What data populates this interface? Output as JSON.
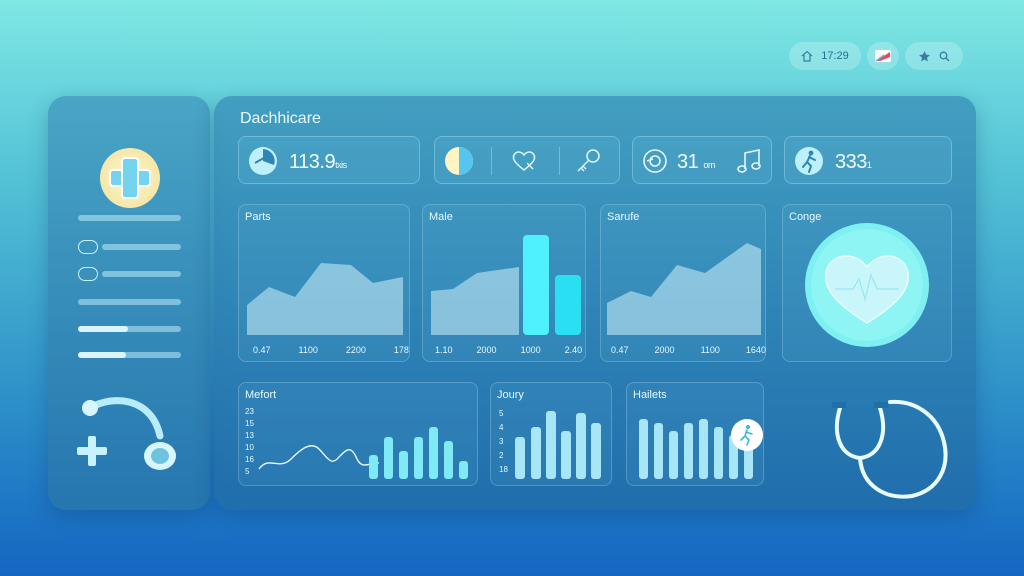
{
  "topbar": {
    "time": "17:29"
  },
  "main": {
    "title": "Dachhicare",
    "stats": [
      {
        "value": "113.9",
        "unit": "txis"
      },
      {
        "value": "31",
        "unit": "om"
      },
      {
        "value": "333",
        "unit": "1"
      }
    ],
    "cards": {
      "parts": {
        "title": "Parts",
        "ticks": [
          "0.47",
          "1100",
          "2200",
          "178"
        ]
      },
      "male": {
        "title": "Male",
        "ticks": [
          "1.10",
          "2000",
          "1000",
          "2.40"
        ]
      },
      "sarufe": {
        "title": "Sarufe",
        "ticks": [
          "0.47",
          "2000",
          "1100",
          "1640"
        ]
      },
      "congo": {
        "title": "Conge"
      },
      "mefort": {
        "title": "Mefort",
        "ylabels": [
          "23",
          "15",
          "13",
          "10",
          "16",
          "5"
        ]
      },
      "joury": {
        "title": "Joury",
        "ylabels": [
          "5",
          "4",
          "3",
          "2",
          "18"
        ]
      },
      "hailets": {
        "title": "Hailets"
      }
    }
  },
  "colors": {
    "accent": "#5ee8f2",
    "bright_bar": "#4ff0ff",
    "soft_bar": "#a8e6f7"
  },
  "icons": [
    "home-icon",
    "flag-icon",
    "star-icon",
    "search-icon",
    "plus-cross-icon",
    "headset-icon",
    "stethoscope-icon",
    "heart-icon",
    "pie-icon",
    "key-icon",
    "disc-icon",
    "music-icon",
    "runner-icon"
  ]
}
